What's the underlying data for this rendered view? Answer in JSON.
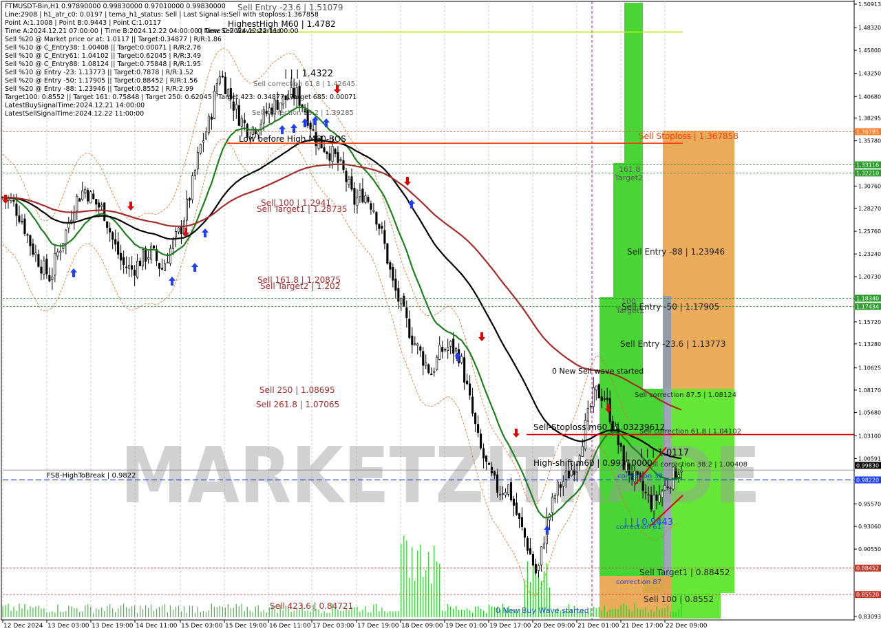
{
  "window": {
    "symbol_line": "FTMUSDT-Bin,H1  0.97890000 0.99830000 0.97010000 0.99830000"
  },
  "info_lines": [
    "FTMUSDT-Bin,H1  0.97890000 0.99830000 0.97010000 0.99830000",
    "Line:2908 | h1_atr_c0: 0.0197 | tema_h1_status: Sell | Last Signal is:Sell with stoploss:1.367858",
    "Point A:1.1008 | Point B:0.9443 | Point C:1.0117",
    "Time A:2024.12.21 07:00:00 | Time B:2024.12.22 04:00:00 | Time C:2024.12.22 11:00:00",
    "Sell %20 @ Market price or at: 1.0117 || Target:0.34877 | R/R:1.86",
    "Sell %10 @ C_Entry38: 1.00408 || Target:0.00071 | R/R:2.76",
    "Sell %10 @ C_Entry61: 1.04102 || Target:0.62045 | R/R:3.49",
    "Sell %10 @ C_Entry88: 1.08124 || Target:0.75848 | R/R:1.95",
    "Sell %10 @ Entry -23: 1.13773 || Target:0.7878 | R/R:1.52",
    "Sell %20 @ Entry -50: 1.17905 || Target:0.88452 | R/R:1.56",
    "Sell %20 @ Entry -88: 1.23946 || Target:0.8552 | R/R:2.99",
    "Target100: 0.8552 || Target 161: 0.75848 | Target 250: 0.62045 | Target 423: 0.34877 | Target 685: 0.00071",
    "LatestBuySignalTime:2024.12.21 14:00:00",
    "LatestSellSignalTime:2024.12.22 11:00:00"
  ],
  "watermark": "MARKETZITRADE",
  "chart_data": {
    "type": "candlestick",
    "symbol": "FTMUSDT-Bin",
    "timeframe": "H1",
    "ylim": [
      0.83093,
      1.5091
    ],
    "price_axis_ticks": [
      1.50913,
      1.4832,
      1.458,
      1.4325,
      1.4068,
      1.38295,
      1.3578,
      1.33116,
      1.3221,
      1.3076,
      1.2827,
      1.2576,
      1.2324,
      1.2073,
      1.1834,
      1.17434,
      1.1572,
      1.1328,
      1.10625,
      1.0817,
      1.0568,
      1.031,
      1.00591,
      0.9983,
      0.9822,
      0.9557,
      0.9306,
      0.9055,
      0.88452,
      0.8552,
      0.83093
    ],
    "price_tags": [
      {
        "value": 1.36785,
        "label": "1.36785",
        "color": "#ff7f2a"
      },
      {
        "value": 1.33116,
        "label": "1.33116",
        "color": "#2e9e2e"
      },
      {
        "value": 1.3221,
        "label": "1.32210",
        "color": "#2e9e2e"
      },
      {
        "value": 1.1834,
        "label": "1.18340",
        "color": "#2e9e2e"
      },
      {
        "value": 1.17434,
        "label": "1.17434",
        "color": "#2e9e2e"
      },
      {
        "value": 0.9983,
        "label": "0.99830",
        "color": "#000000"
      },
      {
        "value": 0.9822,
        "label": "0.98220",
        "color": "#1f3fff"
      },
      {
        "value": 0.88452,
        "label": "0.88452",
        "color": "#c0392b"
      },
      {
        "value": 0.8552,
        "label": "0.85520",
        "color": "#c0392b"
      }
    ],
    "time_labels": [
      "12 Dec 2024",
      "13 Dec 03:00",
      "13 Dec 19:00",
      "14 Dec 11:00",
      "15 Dec 03:00",
      "15 Dec 19:00",
      "16 Dec 11:00",
      "17 Dec 03:00",
      "17 Dec 19:00",
      "18 Dec 09:00",
      "19 Dec 01:00",
      "19 Dec 17:00",
      "20 Dec 09:00",
      "21 Dec 01:00",
      "21 Dec 17:00",
      "22 Dec 09:00"
    ],
    "close_path": [
      [
        0,
        1.295
      ],
      [
        2,
        1.29
      ],
      [
        4,
        1.27
      ],
      [
        6,
        1.24
      ],
      [
        8,
        1.22
      ],
      [
        10,
        1.205
      ],
      [
        11,
        1.228
      ],
      [
        13,
        1.255
      ],
      [
        15,
        1.29
      ],
      [
        17,
        1.305
      ],
      [
        19,
        1.29
      ],
      [
        21,
        1.28
      ],
      [
        23,
        1.245
      ],
      [
        25,
        1.22
      ],
      [
        27,
        1.215
      ],
      [
        29,
        1.228
      ],
      [
        31,
        1.235
      ],
      [
        33,
        1.215
      ],
      [
        35,
        1.24
      ],
      [
        37,
        1.26
      ],
      [
        39,
        1.3
      ],
      [
        41,
        1.35
      ],
      [
        43,
        1.38
      ],
      [
        45,
        1.435
      ],
      [
        47,
        1.41
      ],
      [
        49,
        1.385
      ],
      [
        51,
        1.37
      ],
      [
        53,
        1.375
      ],
      [
        55,
        1.39
      ],
      [
        57,
        1.4
      ],
      [
        59,
        1.405
      ],
      [
        61,
        1.41
      ],
      [
        63,
        1.39
      ],
      [
        65,
        1.36
      ],
      [
        67,
        1.35
      ],
      [
        69,
        1.34
      ],
      [
        71,
        1.32
      ],
      [
        73,
        1.29
      ],
      [
        75,
        1.3
      ],
      [
        77,
        1.285
      ],
      [
        79,
        1.25
      ],
      [
        81,
        1.2
      ],
      [
        83,
        1.17
      ],
      [
        85,
        1.14
      ],
      [
        87,
        1.12
      ],
      [
        89,
        1.1
      ],
      [
        91,
        1.125
      ],
      [
        93,
        1.13
      ],
      [
        95,
        1.12
      ],
      [
        97,
        1.07
      ],
      [
        99,
        1.02
      ],
      [
        101,
        0.99
      ],
      [
        103,
        0.97
      ],
      [
        105,
        0.975
      ],
      [
        107,
        0.94
      ],
      [
        109,
        0.91
      ],
      [
        111,
        0.875
      ],
      [
        113,
        0.935
      ],
      [
        115,
        0.97
      ],
      [
        117,
        0.985
      ],
      [
        119,
        1.0
      ],
      [
        121,
        1.04
      ],
      [
        123,
        1.08
      ],
      [
        125,
        1.075
      ],
      [
        127,
        1.04
      ],
      [
        129,
        1.0
      ],
      [
        131,
        0.985
      ],
      [
        133,
        0.97
      ],
      [
        135,
        0.955
      ],
      [
        137,
        0.97
      ],
      [
        139,
        0.985
      ],
      [
        141,
        0.9983
      ]
    ],
    "levels": [
      {
        "name": "HighestHigh M60",
        "label": "HighestHigh   M60 | 1.4782",
        "value": 1.4782,
        "color": "#b7f000"
      },
      {
        "name": "Sell Stoploss",
        "label": "Sell Stoploss | 1.367858",
        "value": 1.367858,
        "color": "#ff3b00"
      },
      {
        "name": "Low before High M60-BOS",
        "label": "Low before High   M60-BOS",
        "value": 1.355,
        "color": "#ff3b00"
      },
      {
        "name": "Sell-Stoploss m60",
        "label": "Sell-Stoploss m60 | 1.03239612",
        "value": 1.0324,
        "color": "#e00000"
      },
      {
        "name": "High-shift m60",
        "label": "High-shift m60 | 0.99310000",
        "value": 0.9931,
        "color": "#606060"
      },
      {
        "name": "FSB-HighToBreak",
        "label": "FSB-HighToBreak | 0.9822",
        "value": 0.9822,
        "color": "#1f3fff"
      }
    ],
    "zones": [
      {
        "label": "Sell Entry -88 | 1.23946"
      },
      {
        "label": "Sell Entry -50 | 1.17905"
      },
      {
        "label": "Sell Entry -23.6 | 1.13773"
      },
      {
        "label": "Sell correction 87.5 | 1.08124"
      },
      {
        "label": "Sell correction 61.8 | 1.04102"
      },
      {
        "label": "Sell correction 38.2 | 1.00408"
      },
      {
        "label": "Sell Target1 | 0.88452"
      },
      {
        "label": "Sell 100 | 0.8552"
      }
    ],
    "annotations": [
      "Sell Entry -23.6 | 1.51079",
      "0 New Sell wave started",
      "| | | 1.4322",
      "Sell correction 61.8 | 1.42645",
      "Sell correction 38.2 | 1.39285",
      "Sell 100 | 1.2941",
      "Sell Target1 | 1.28735",
      "Sell 161.8 | 1.20875",
      "Sell Target2 | 1.202",
      "Sell  250 | 1.08695",
      "Sell  261.8 | 1.07065",
      "Sell  423.6 | 0.84721",
      "161.8",
      "Target2",
      "100",
      "Target1",
      "0 New Sell wave started",
      "| | | 1.0117",
      "correction 38",
      "| | | 0.9443",
      "correction 61",
      "correction 87",
      "0 New Buy Wave started"
    ],
    "moving_averages": [
      {
        "color": "#1e7d1e"
      },
      {
        "color": "#000000"
      },
      {
        "color": "#a52a2a"
      }
    ]
  }
}
